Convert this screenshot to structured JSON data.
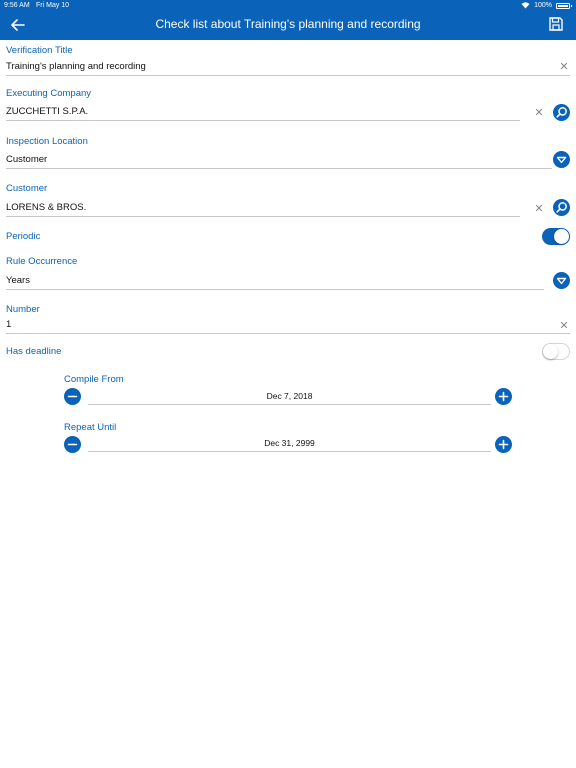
{
  "status_bar": {
    "time": "9:56 AM",
    "date": "Fri May 10",
    "battery": "100%",
    "battery_level": 1.0
  },
  "header": {
    "title": "Check list about Training's planning and recording"
  },
  "form": {
    "verification_title": {
      "label": "Verification Title",
      "value": "Training's planning and recording"
    },
    "executing_company": {
      "label": "Executing Company",
      "value": "ZUCCHETTI S.P.A."
    },
    "inspection_location": {
      "label": "Inspection Location",
      "value": "Customer"
    },
    "customer": {
      "label": "Customer",
      "value": "LORENS & BROS."
    },
    "periodic": {
      "label": "Periodic",
      "on": true
    },
    "rule_occurrence": {
      "label": "Rule Occurrence",
      "value": "Years"
    },
    "number": {
      "label": "Number",
      "value": "1"
    },
    "has_deadline": {
      "label": "Has deadline",
      "on": false
    },
    "compile_from": {
      "label": "Compile From",
      "value": "Dec 7, 2018"
    },
    "repeat_until": {
      "label": "Repeat Until",
      "value": "Dec 31, 2999"
    }
  },
  "colors": {
    "accent": "#0a63b8",
    "divider": "#c8c8c8"
  },
  "icons": {
    "back": "arrow-left-icon",
    "save": "floppy-disk-icon",
    "clear": "close-icon",
    "search": "search-icon",
    "dropdown": "chevron-down-icon",
    "minus": "minus-icon",
    "plus": "plus-icon"
  }
}
